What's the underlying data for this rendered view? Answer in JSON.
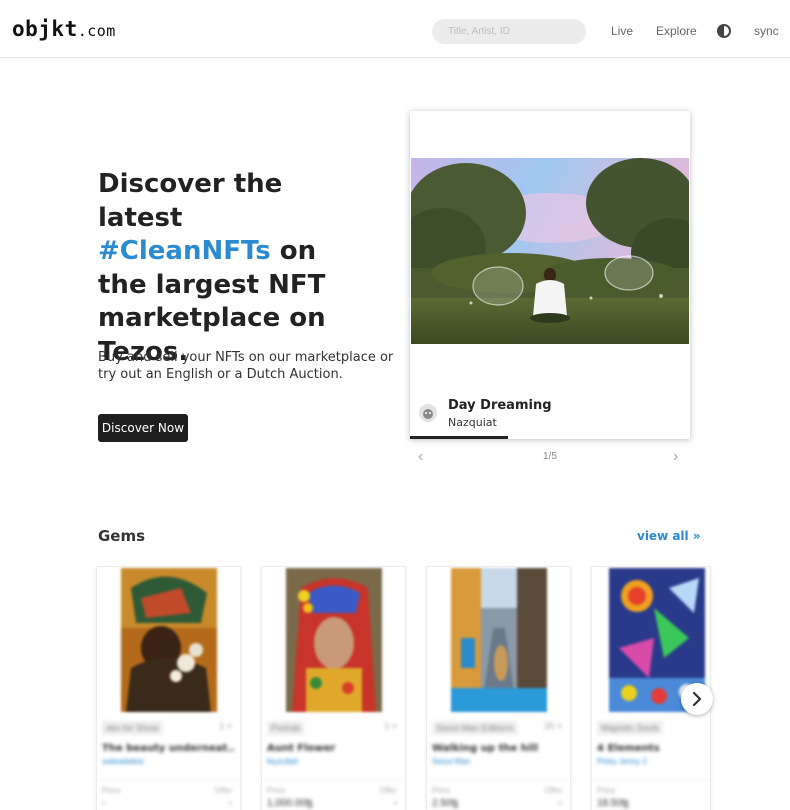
{
  "header": {
    "logo_main": "objkt",
    "logo_suffix": ".com",
    "search_placeholder": "Title, Artist, ID",
    "nav": [
      "Live",
      "Explore",
      "sync"
    ],
    "theme_icon": "contrast-icon"
  },
  "hero": {
    "title_line1": "Discover the latest",
    "title_accent": "#CleanNFTs",
    "title_rest": " on the largest NFT marketplace on Tezos.",
    "subtitle": "Buy and sell your NFTs on our marketplace or try out an English or a Dutch Auction.",
    "cta": "Discover Now",
    "accent_color": "#2a8bd1"
  },
  "featured": {
    "title": "Day Dreaming",
    "artist": "Nazquiat",
    "counter": "1/5",
    "prev_icon": "chevron-left-icon",
    "next_icon": "chevron-right-icon"
  },
  "gems": {
    "title": "Gems",
    "view_all": "view all »",
    "price_label": "Price",
    "offer_label": "Offer",
    "items": [
      {
        "collection": "oko for Show",
        "editions": "1 ×",
        "title": "The beauty underneat...",
        "artist": "waleadebisi",
        "price": "-",
        "offer": "-"
      },
      {
        "collection": "Portrait",
        "editions": "1 ×",
        "title": "Aunt Flower",
        "artist": "feyzullah",
        "price": "1,000.00ꜩ",
        "offer": "-"
      },
      {
        "collection": "Seoul Man Editions",
        "editions": "20 ×",
        "title": "Walking up the hill",
        "artist": "Seoul Man",
        "price": "2.50ꜩ",
        "offer": "-"
      },
      {
        "collection": "Majestic Souls",
        "editions": "1 ×",
        "title": "4 Elements",
        "artist": "Pinky Jenny 2",
        "price": "18.50ꜩ",
        "offer": "-"
      }
    ]
  }
}
